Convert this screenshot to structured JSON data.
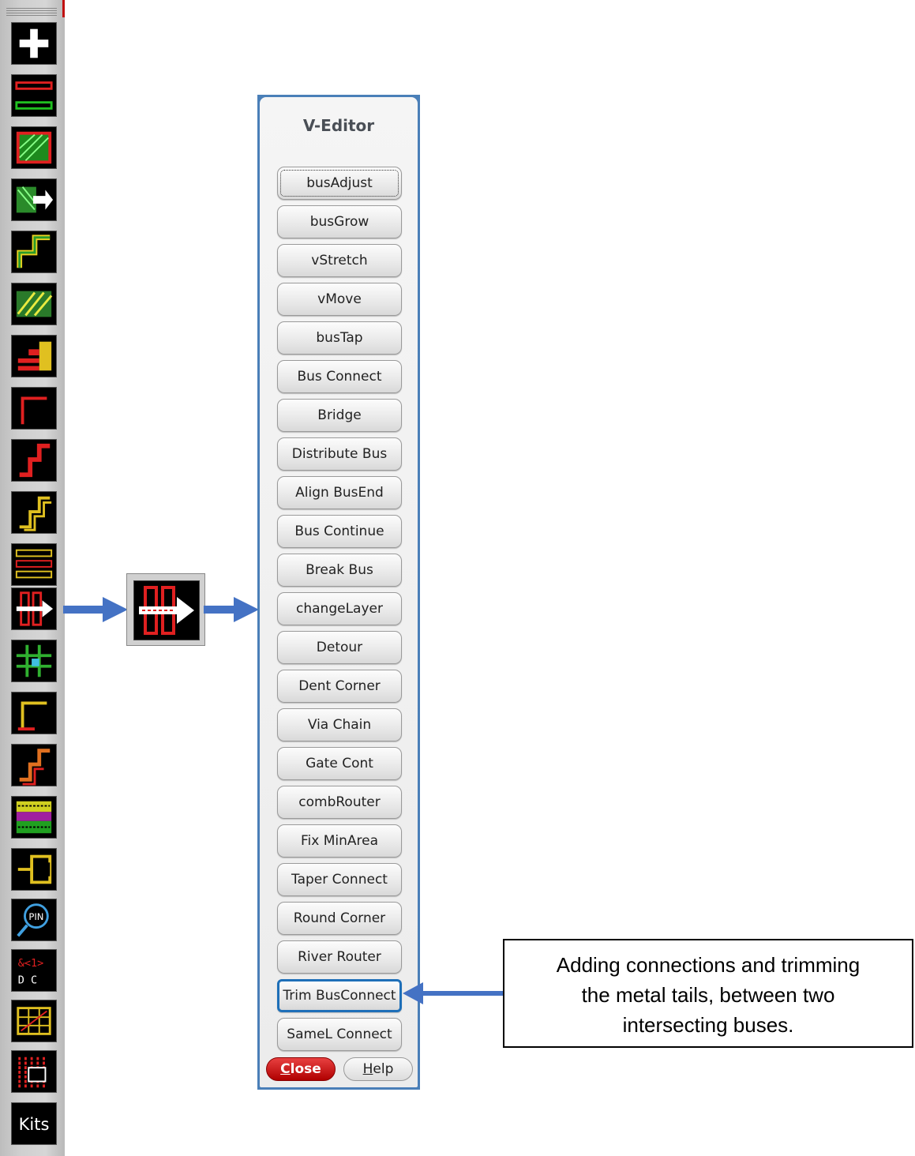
{
  "toolbar": {
    "tools": [
      "plus-icon",
      "layer-stripes-icon",
      "green-hatch-icon",
      "move-arrow-icon",
      "step-path-icon",
      "hatched-block-icon",
      "pin-stack-icon",
      "corner-path-icon",
      "red-step-icon",
      "yellow-step-icon",
      "bus-lines-icon",
      "v-editor-icon",
      "cross-via-icon",
      "l-path-icon",
      "orange-step-icon",
      "striped-pattern-icon",
      "connector-icon",
      "pin-search-icon",
      "label-text-icon",
      "grid-block-icon",
      "red-grid-icon"
    ],
    "kits_label": "Kits"
  },
  "panel": {
    "title": "V-Editor",
    "buttons": [
      "busAdjust",
      "busGrow",
      "vStretch",
      "vMove",
      "busTap",
      "Bus Connect",
      "Bridge",
      "Distribute Bus",
      "Align BusEnd",
      "Bus Continue",
      "Break Bus",
      "changeLayer",
      "Detour",
      "Dent Corner",
      "Via Chain",
      "Gate Cont",
      "combRouter",
      "Fix MinArea",
      "Taper Connect",
      "Round Corner",
      "River Router",
      "Trim BusConnect",
      "SameL Connect"
    ],
    "focused_button": "busAdjust",
    "highlighted_button": "Trim BusConnect",
    "close_label_first": "C",
    "close_label_rest": "lose",
    "help_label_first": "H",
    "help_label_rest": "elp"
  },
  "callout": {
    "line1": "Adding connections and trimming",
    "line2": "the metal tails, between two",
    "line3": "intersecting buses."
  },
  "colors": {
    "accent_blue": "#4472c4",
    "highlight_blue": "#1e6fb8",
    "close_red": "#c00000"
  }
}
